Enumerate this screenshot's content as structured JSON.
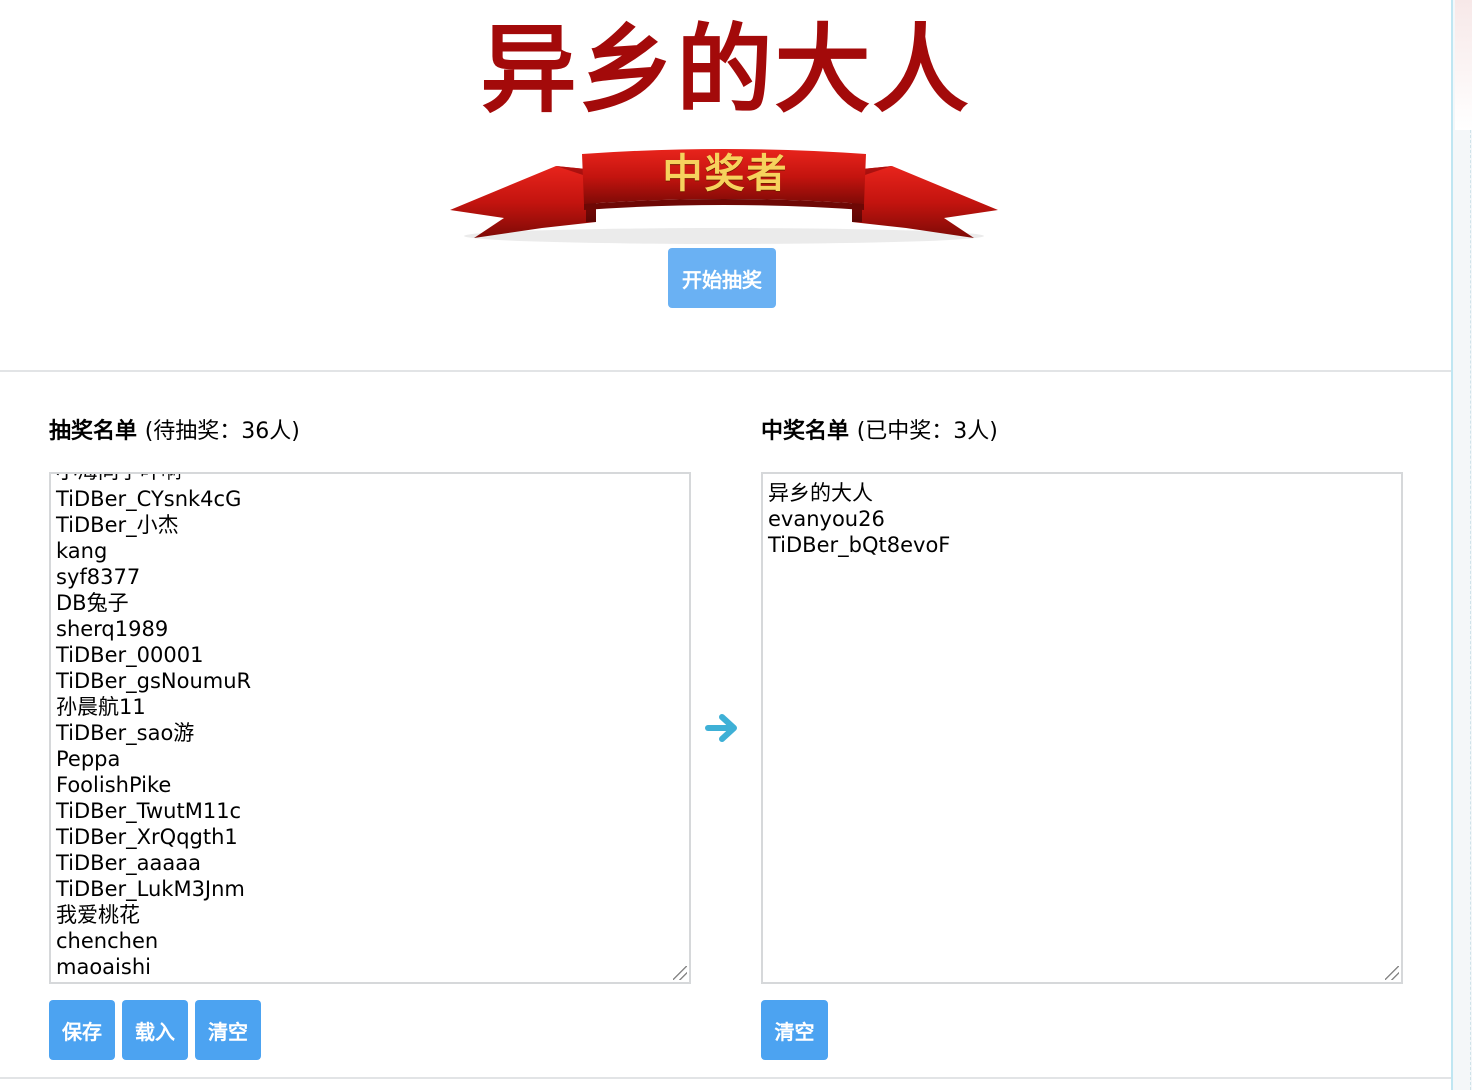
{
  "header": {
    "winner_name": "异乡的大人",
    "ribbon_text": "中奖者",
    "start_button": "开始抽奖"
  },
  "left_panel": {
    "title": "抽奖名单",
    "subtitle": "(待抽奖：36人)",
    "partial_top_line": "小海同学叶啊",
    "names": [
      "TiDBer_CYsnk4cG",
      "TiDBer_小杰",
      "kang",
      "syf8377",
      "DB兔子",
      "sherq1989",
      "TiDBer_00001",
      "TiDBer_gsNoumuR",
      "孙晨航11",
      "TiDBer_sao游",
      "Peppa",
      "FoolishPike",
      "TiDBer_TwutM11c",
      "TiDBer_XrQqgth1",
      "TiDBer_aaaaa",
      "TiDBer_LukM3Jnm",
      "我爱桃花",
      "chenchen",
      "maoaishi"
    ],
    "buttons": {
      "save": "保存",
      "load": "载入",
      "clear": "清空"
    }
  },
  "right_panel": {
    "title": "中奖名单",
    "subtitle": "(已中奖：3人)",
    "names": [
      "异乡的大人",
      "evanyou26",
      "TiDBer_bQt8evoF"
    ],
    "buttons": {
      "clear": "清空"
    }
  },
  "icons": {
    "transfer": "arrow-right-icon"
  },
  "colors": {
    "title_red": "#a30a0a",
    "button_blue": "#4ca3f1",
    "start_button_blue": "#6ab1f3",
    "ribbon_gold": "#f6d25d"
  }
}
